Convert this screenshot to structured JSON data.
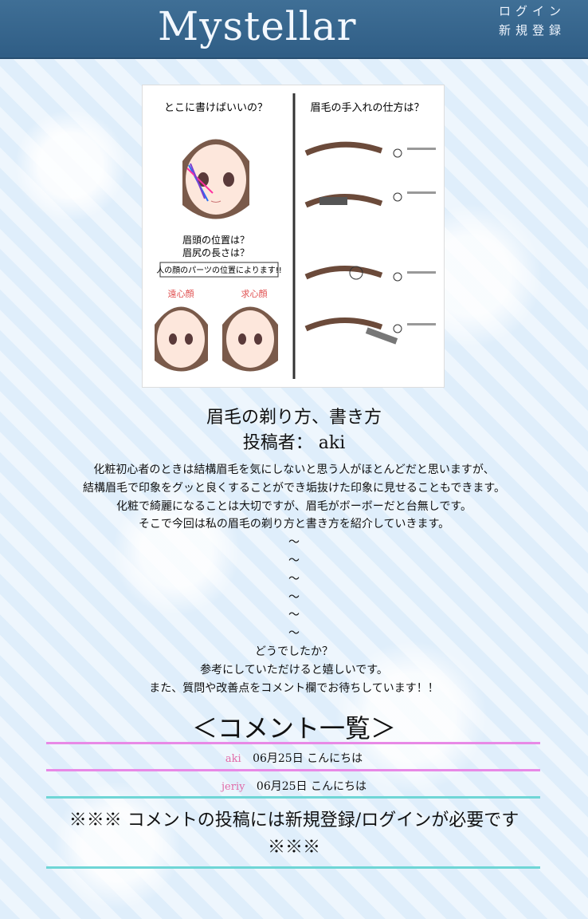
{
  "header": {
    "logo": "Mystellar",
    "login": "ログイン",
    "register": "新規登録"
  },
  "article": {
    "title": "眉毛の剃り方、書き方",
    "author_label": "投稿者：",
    "author_name": "aki",
    "lines": [
      "化粧初心者のときは結構眉毛を気にしないと思う人がほとんどだと思いますが、",
      "結構眉毛で印象をグッと良くすることができ垢抜けた印象に見せることもできます。",
      "化粧で綺麗になることは大切ですが、眉毛がボーボーだと台無しです。",
      "そこで今回は私の眉毛の剃り方と書き方を紹介していきます。",
      "〜",
      "〜",
      "〜",
      "〜",
      "〜",
      "〜",
      "どうでしたか？",
      "参考にしていただけると嬉しいです。",
      "また、質問や改善点をコメント欄でお待ちしています！！"
    ]
  },
  "illustration": {
    "left_title": "とこに書けばいいの？",
    "right_title": "眉毛の手入れの仕方は？",
    "mid_title": "眉頭の位置は？",
    "mid_title2": "眉尻の長さは？",
    "banner": "人の顔のパーツの位置によります!!",
    "face1_label": "遠心顔",
    "face2_label": "求心顔"
  },
  "comments": {
    "heading": "＜コメント一覧＞",
    "items": [
      {
        "user": "aki",
        "date": "06月25日",
        "text": "こんにちは"
      },
      {
        "user": "jeriy",
        "date": "06月25日",
        "text": "こんにちは"
      }
    ],
    "notice": "※※※ コメントの投稿には新規登録/ログインが必要です ※※※"
  }
}
